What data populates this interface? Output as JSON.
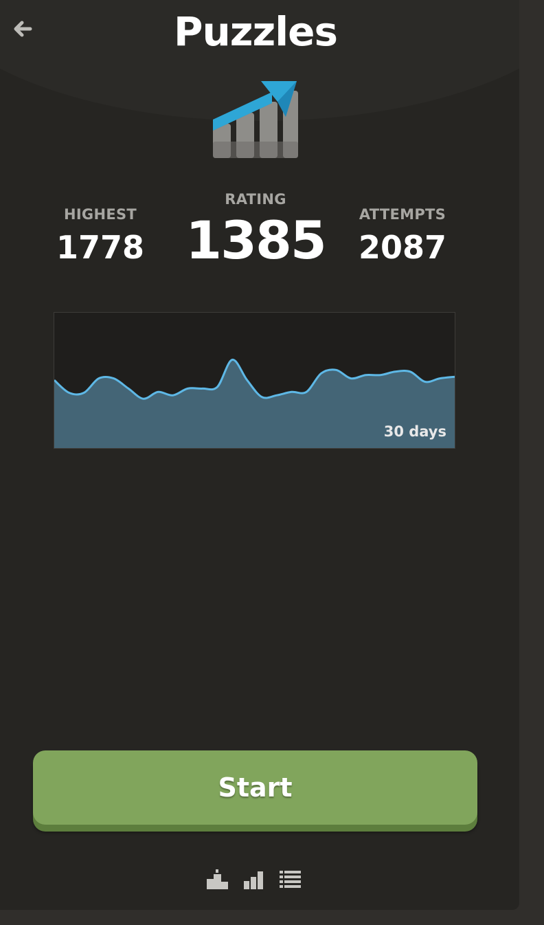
{
  "header": {
    "title": "Puzzles",
    "back_icon": "back-arrow-icon",
    "hero_icon": "rating-trend-chart-icon"
  },
  "stats": {
    "highest": {
      "label": "HIGHEST",
      "value": "1778"
    },
    "rating": {
      "label": "RATING",
      "value": "1385"
    },
    "attempts": {
      "label": "ATTEMPTS",
      "value": "2087"
    }
  },
  "history": {
    "period_label": "30 days",
    "line_color": "#5eb8e6",
    "fill_color": "#446576"
  },
  "chart_data": {
    "type": "area",
    "y_relative": true,
    "values": [
      1360,
      1345,
      1345,
      1362,
      1362,
      1350,
      1338,
      1346,
      1342,
      1350,
      1350,
      1352,
      1384,
      1360,
      1340,
      1342,
      1346,
      1346,
      1368,
      1372,
      1362,
      1366,
      1366,
      1370,
      1370,
      1358,
      1362,
      1364
    ]
  },
  "actions": {
    "start_label": "Start"
  },
  "footer": {
    "icons": [
      "leaderboard-icon",
      "stats-icon",
      "history-list-icon"
    ]
  },
  "colors": {
    "background": "#262522",
    "accent_green": "#81a55c",
    "accent_blue": "#2ea6d6"
  }
}
